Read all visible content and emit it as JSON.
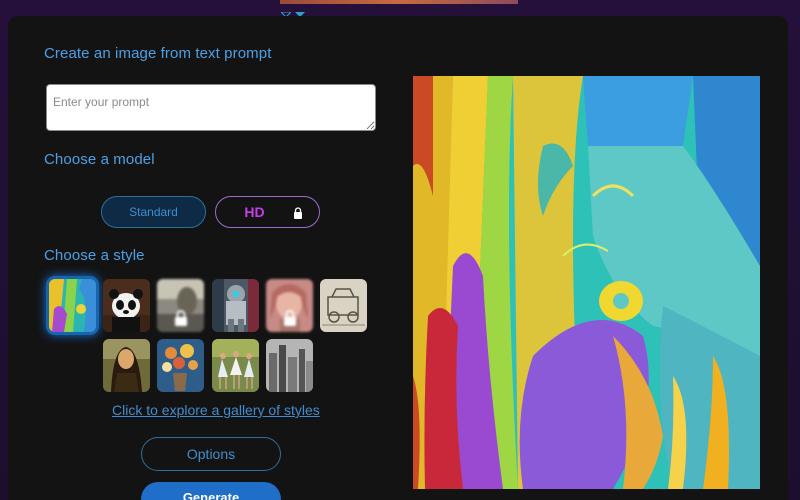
{
  "headings": {
    "create": "Create an image from text prompt",
    "model": "Choose a model",
    "style": "Choose a style"
  },
  "prompt": {
    "placeholder": "Enter your prompt",
    "value": ""
  },
  "models": {
    "standard_label": "Standard",
    "hd_label": "HD",
    "selected": "Standard"
  },
  "styles": [
    {
      "name": "abstract-painting",
      "selected": true,
      "locked": false
    },
    {
      "name": "panda-portrait",
      "selected": false,
      "locked": false
    },
    {
      "name": "blurred-locked-1",
      "selected": false,
      "locked": true
    },
    {
      "name": "robot-art",
      "selected": false,
      "locked": false
    },
    {
      "name": "portrait-locked",
      "selected": false,
      "locked": true
    },
    {
      "name": "sketch-vehicle",
      "selected": false,
      "locked": false
    },
    {
      "name": "mona-lisa",
      "selected": false,
      "locked": false
    },
    {
      "name": "flower-vase",
      "selected": false,
      "locked": false
    },
    {
      "name": "dancers",
      "selected": false,
      "locked": false
    },
    {
      "name": "city-sketch",
      "selected": false,
      "locked": false
    }
  ],
  "links": {
    "explore": "Click to explore a gallery of styles"
  },
  "buttons": {
    "options": "Options",
    "generate": "Generate"
  },
  "preview": {
    "watermark": ""
  },
  "colors": {
    "accent": "#4aa0e6",
    "hd_accent": "#c53fe8",
    "panel": "#131313",
    "primary_button": "#1f6fc9"
  }
}
